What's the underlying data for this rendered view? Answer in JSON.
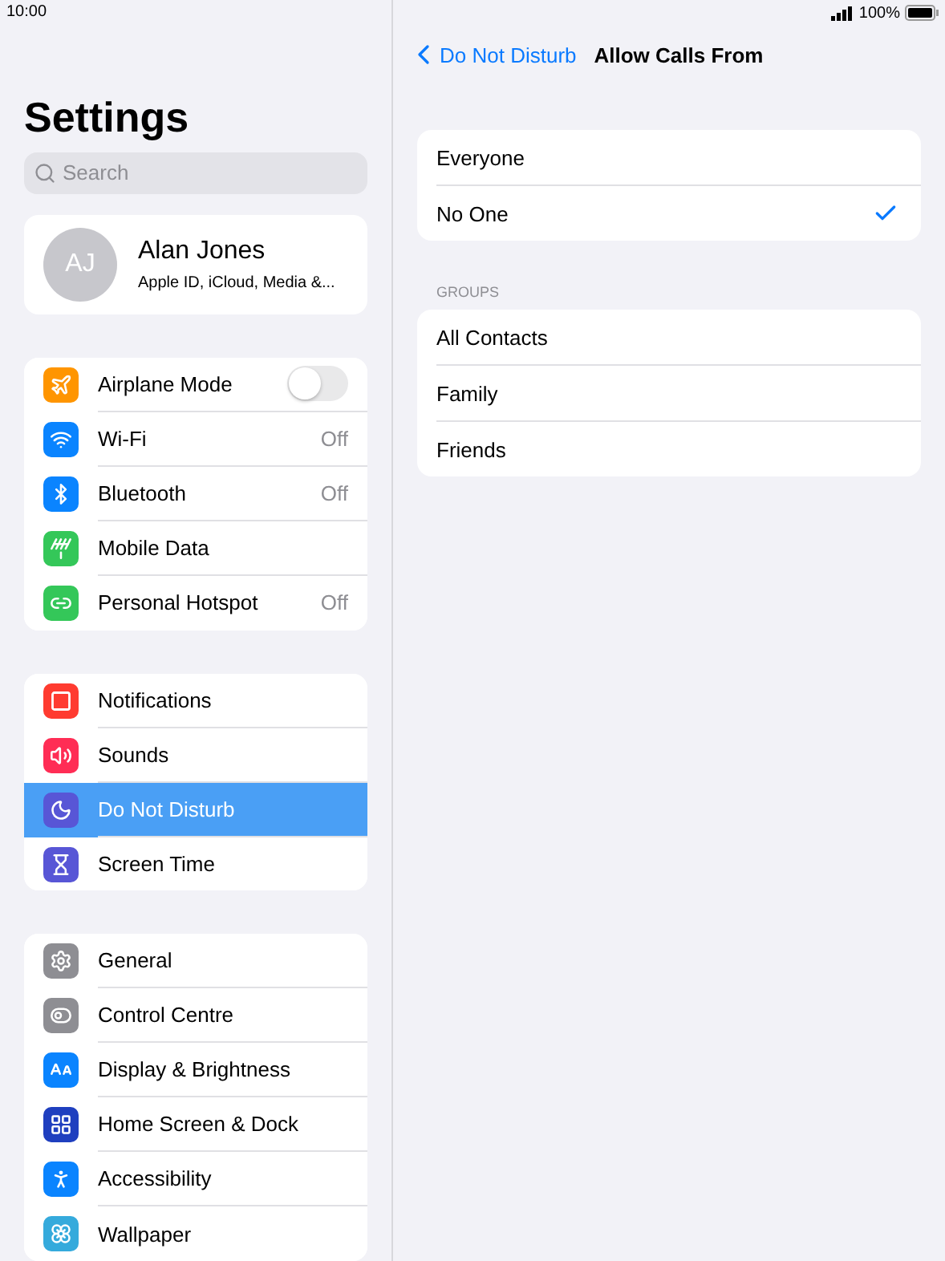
{
  "status_bar": {
    "time": "10:00",
    "battery": "100%"
  },
  "sidebar": {
    "title": "Settings",
    "search": {
      "placeholder": "Search"
    },
    "profile": {
      "initials": "AJ",
      "name": "Alan Jones",
      "subtitle": "Apple ID, iCloud, Media &..."
    },
    "groups": [
      {
        "items": [
          {
            "label": "Airplane Mode",
            "kind": "toggle",
            "on": false,
            "color": "#ff9500",
            "selected": false
          },
          {
            "label": "Wi-Fi",
            "kind": "value",
            "value": "Off",
            "color": "#0a84ff",
            "selected": false
          },
          {
            "label": "Bluetooth",
            "kind": "value",
            "value": "Off",
            "color": "#0a84ff",
            "selected": false
          },
          {
            "label": "Mobile Data",
            "kind": "plain",
            "color": "#34c759",
            "selected": false
          },
          {
            "label": "Personal Hotspot",
            "kind": "value",
            "value": "Off",
            "color": "#34c759",
            "selected": false
          }
        ]
      },
      {
        "items": [
          {
            "label": "Notifications",
            "kind": "plain",
            "color": "#ff3b30",
            "selected": false
          },
          {
            "label": "Sounds",
            "kind": "plain",
            "color": "#ff2d55",
            "selected": false
          },
          {
            "label": "Do Not Disturb",
            "kind": "plain",
            "color": "#5856d6",
            "selected": true
          },
          {
            "label": "Screen Time",
            "kind": "plain",
            "color": "#5856d6",
            "selected": false
          }
        ]
      },
      {
        "items": [
          {
            "label": "General",
            "kind": "plain",
            "color": "#8e8e93",
            "selected": false
          },
          {
            "label": "Control Centre",
            "kind": "plain",
            "color": "#8e8e93",
            "selected": false
          },
          {
            "label": "Display & Brightness",
            "kind": "plain",
            "color": "#0a84ff",
            "selected": false
          },
          {
            "label": "Home Screen & Dock",
            "kind": "plain",
            "color": "#1f3fbf",
            "selected": false
          },
          {
            "label": "Accessibility",
            "kind": "plain",
            "color": "#0a84ff",
            "selected": false
          },
          {
            "label": "Wallpaper",
            "kind": "plain",
            "color": "#35aadc",
            "selected": false
          }
        ]
      }
    ]
  },
  "detail": {
    "back": "Do Not Disturb",
    "title": "Allow Calls From",
    "options": [
      {
        "label": "Everyone",
        "selected": false
      },
      {
        "label": "No One",
        "selected": true
      }
    ],
    "groups_header": "GROUPS",
    "groups": [
      {
        "label": "All Contacts"
      },
      {
        "label": "Family"
      },
      {
        "label": "Friends"
      }
    ]
  }
}
